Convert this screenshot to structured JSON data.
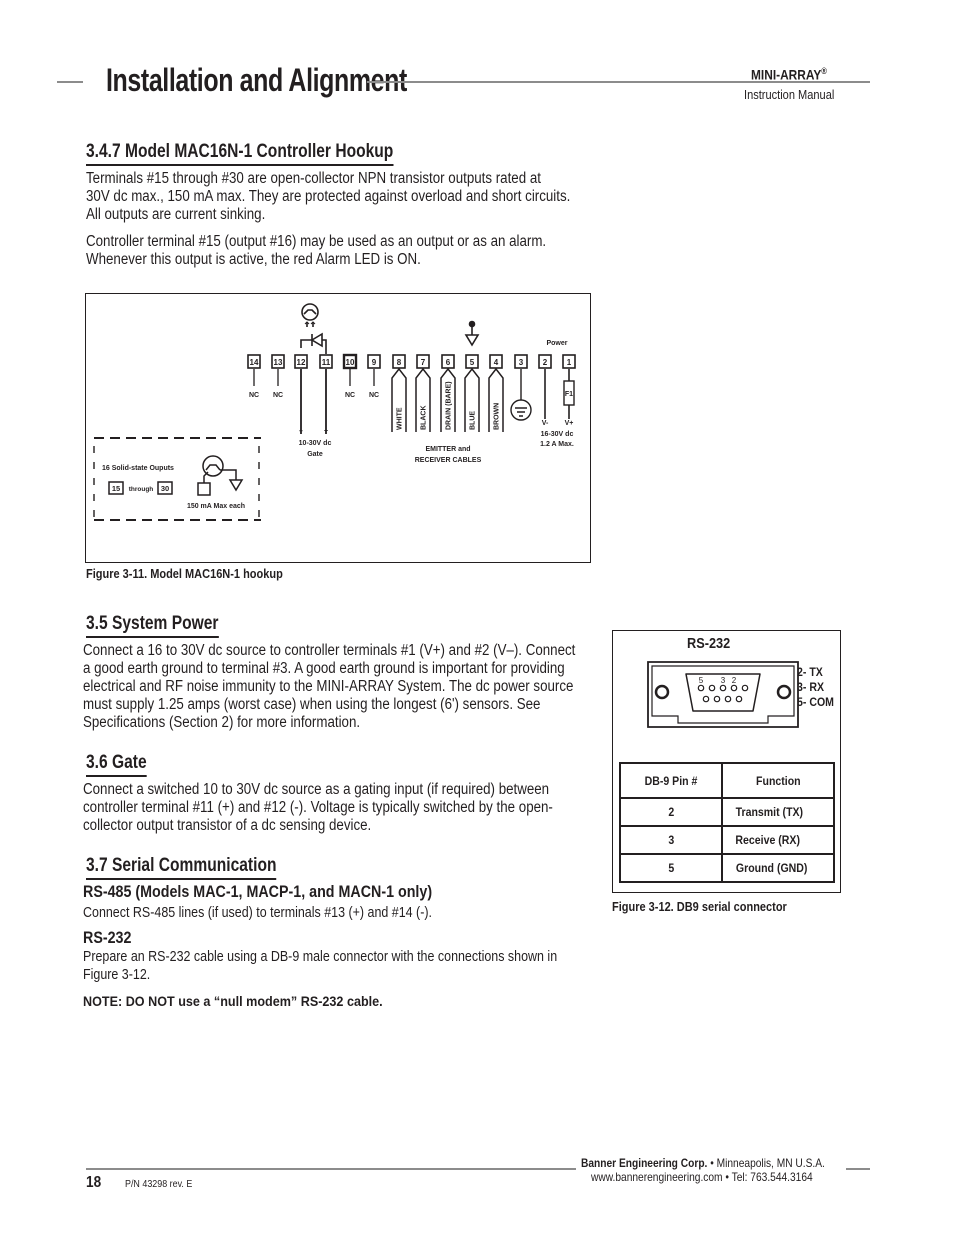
{
  "header": {
    "title": "Installation and Alignment",
    "brand": "MINI-ARRAY",
    "brand_mark": "®",
    "subtitle": "Instruction Manual"
  },
  "sections": {
    "s347": {
      "heading": "3.4.7  Model MAC16N-1 Controller Hookup",
      "p1": [
        "Terminals #15 through #30 are open-collector NPN transistor outputs rated at",
        "30V dc max., 150 mA max. They are protected against overload and short circuits.",
        "All outputs are current sinking."
      ],
      "p2": [
        "Controller terminal #15 (output #16) may be used as an output or as an alarm.",
        "Whenever this output is active, the red Alarm LED is ON."
      ]
    },
    "s35": {
      "heading": "3.5  System Power",
      "p1": [
        "Connect a 16 to 30V dc source to controller terminals #1 (V+) and #2 (V–). Connect",
        "a good earth ground to terminal #3. A good earth ground is important for providing",
        "electrical and RF noise immunity to the MINI-ARRAY System. The dc power source",
        "must supply 1.25 amps (worst case) when using the longest (6') sensors. See",
        "Specifications (Section 2) for more information."
      ]
    },
    "s36": {
      "heading": "3.6  Gate",
      "p1": [
        "Connect a switched 10 to 30V dc source as a gating input (if required) between",
        "controller terminal #11 (+) and #12 (-). Voltage is typically switched by the open-",
        "collector output transistor of a dc sensing device."
      ]
    },
    "s37": {
      "heading": "3.7  Serial Communication",
      "rs485_heading": "RS-485 (Models MAC-1, MACP-1, and MACN-1 only)",
      "rs485_text": "Connect RS-485 lines (if used) to terminals #13 (+) and #14 (-).",
      "rs232_heading": "RS-232",
      "rs232_text": [
        "Prepare an RS-232 cable using a DB-9 male connector with the connections shown in",
        "Figure 3-12."
      ],
      "note": "NOTE: DO NOT use a “null modem” RS-232 cable."
    }
  },
  "figure_3_11": {
    "caption": "Figure 3-11.  Model MAC16N-1 hookup",
    "terminals": [
      "14",
      "13",
      "12",
      "11",
      "10",
      "9",
      "8",
      "7",
      "6",
      "5",
      "4",
      "3",
      "2",
      "1"
    ],
    "nc_labels": [
      "NC",
      "NC",
      "NC",
      "NC"
    ],
    "power_label": "Power",
    "fuse_label": "F1",
    "v_minus": "V-",
    "v_plus": "V+",
    "power_spec": [
      "16-30V dc",
      "1.2 A Max."
    ],
    "gate_minus": "–",
    "gate_plus": "+",
    "gate_spec": [
      "10-30V dc",
      "Gate"
    ],
    "cable_colors": [
      "WHITE",
      "BLACK",
      "DRAIN (BARE)",
      "BLUE",
      "BROWN"
    ],
    "cables_label": [
      "EMITTER and",
      "RECEIVER CABLES"
    ],
    "outputs_label": "16 Solid-state Ouputs",
    "outputs_from": "15",
    "outputs_through": "through",
    "outputs_to": "30",
    "outputs_rating": "150 mA Max each"
  },
  "figure_3_12": {
    "caption": "Figure 3-12.  DB9 serial connector",
    "title": "RS-232",
    "pin_numbers_shown": [
      "5",
      "3",
      "2"
    ],
    "pin_map": [
      "2- TX",
      "3- RX",
      "5- COM"
    ],
    "table": {
      "headers": [
        "DB-9 Pin #",
        "Function"
      ],
      "rows": [
        [
          "2",
          "Transmit (TX)"
        ],
        [
          "3",
          "Receive (RX)"
        ],
        [
          "5",
          "Ground (GND)"
        ]
      ]
    }
  },
  "footer": {
    "page_number": "18",
    "part_number": "P/N 43298 rev. E",
    "company": "Banner Engineering Corp.",
    "location": " • Minneapolis, MN U.S.A.",
    "contact": "www.bannerengineering.com  •  Tel: 763.544.3164"
  }
}
